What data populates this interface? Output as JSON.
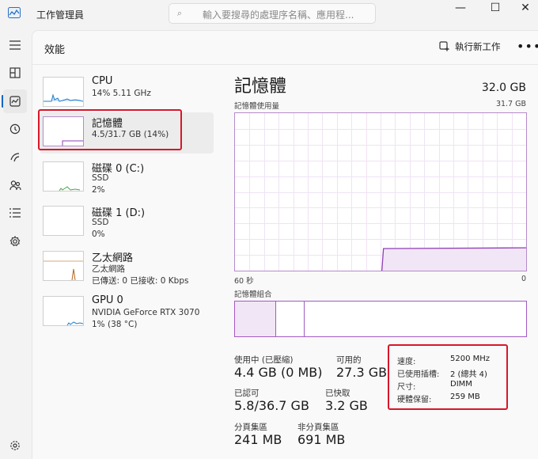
{
  "app": {
    "title": "工作管理員",
    "search_placeholder": "輸入要搜尋的處理序名稱、應用程...",
    "window_controls": {
      "minimize": "—",
      "maximize": "☐",
      "close": "✕"
    }
  },
  "rail": {
    "icons": [
      "hamburger-icon",
      "processes-icon",
      "performance-icon",
      "app-history-icon",
      "startup-apps-icon",
      "users-icon",
      "details-icon",
      "services-icon",
      "settings-icon"
    ],
    "active": "performance-icon"
  },
  "header": {
    "title": "效能",
    "new_task_label": "執行新工作",
    "more_label": "•••"
  },
  "sidebar": {
    "items": [
      {
        "name": "CPU",
        "line1": "14% 5.11 GHz",
        "line2": ""
      },
      {
        "name": "記憶體",
        "line1": "4.5/31.7 GB (14%)",
        "line2": ""
      },
      {
        "name": "磁碟 0 (C:)",
        "line1": "SSD",
        "line2": "2%"
      },
      {
        "name": "磁碟 1 (D:)",
        "line1": "SSD",
        "line2": "0%"
      },
      {
        "name": "乙太網路",
        "line1": "乙太網路",
        "line2": "已傳送: 0 已接收: 0 Kbps"
      },
      {
        "name": "GPU 0",
        "line1": "NVIDIA GeForce RTX 3070",
        "line2": "1% (38 °C)"
      }
    ]
  },
  "detail": {
    "title": "記憶體",
    "total": "32.0 GB",
    "usage_label": "記憶體使用量",
    "usage_max": "31.7 GB",
    "time_left": "60 秒",
    "time_right": "0",
    "composition_label": "記憶體組合",
    "stats": {
      "in_use_label": "使用中 (已壓縮)",
      "in_use_value": "4.4 GB (0 MB)",
      "available_label": "可用的",
      "available_value": "27.3 GB",
      "committed_label": "已認可",
      "committed_value": "5.8/36.7 GB",
      "cached_label": "已快取",
      "cached_value": "3.2 GB",
      "paged_label": "分頁集區",
      "paged_value": "241 MB",
      "nonpaged_label": "非分頁集區",
      "nonpaged_value": "691 MB"
    },
    "specs": [
      {
        "label": "速度:",
        "value": "5200 MHz"
      },
      {
        "label": "已使用插槽:",
        "value": "2 (總共 4)"
      },
      {
        "label": "尺寸:",
        "value": "DIMM"
      },
      {
        "label": "硬體保留:",
        "value": "259 MB"
      }
    ],
    "usage_level_percent": 14
  },
  "colors": {
    "memory_accent": "#8e3fb5",
    "memory_fill": "#f1e6f5",
    "cpu_accent": "#1f7ec9",
    "disk_accent": "#4ca64c",
    "ethernet_accent": "#b5651d",
    "highlight_red": "#d9162a"
  }
}
